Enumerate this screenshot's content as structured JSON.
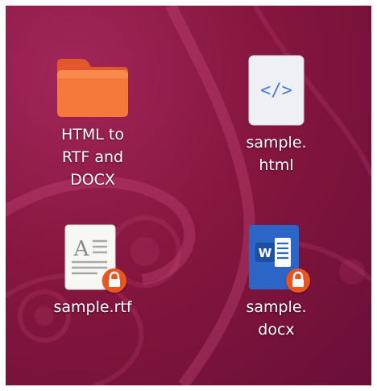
{
  "desktop": {
    "icons": [
      {
        "label": "HTML to RTF and DOCX",
        "label_lines": [
          "HTML to",
          "RTF and",
          "DOCX"
        ],
        "type": "folder",
        "icon": "folder-icon"
      },
      {
        "label": "sample.html",
        "label_lines": [
          "sample.",
          "html"
        ],
        "type": "file",
        "icon": "html-file-icon",
        "glyph": "</>"
      },
      {
        "label": "sample.rtf",
        "label_lines": [
          "sample.rtf"
        ],
        "type": "file",
        "icon": "rtf-file-icon",
        "glyph": "A",
        "locked": true,
        "emblem": "lock-icon"
      },
      {
        "label": "sample.docx",
        "label_lines": [
          "sample.",
          "docx"
        ],
        "type": "file",
        "icon": "docx-file-icon",
        "glyph": "W",
        "locked": true,
        "emblem": "lock-icon"
      }
    ]
  },
  "colors": {
    "wallpaper": "#86163f",
    "folder": "#f5793a",
    "lock_emblem": "#e95420",
    "word_blue": "#2b66c7",
    "label_text": "#ffffff"
  }
}
